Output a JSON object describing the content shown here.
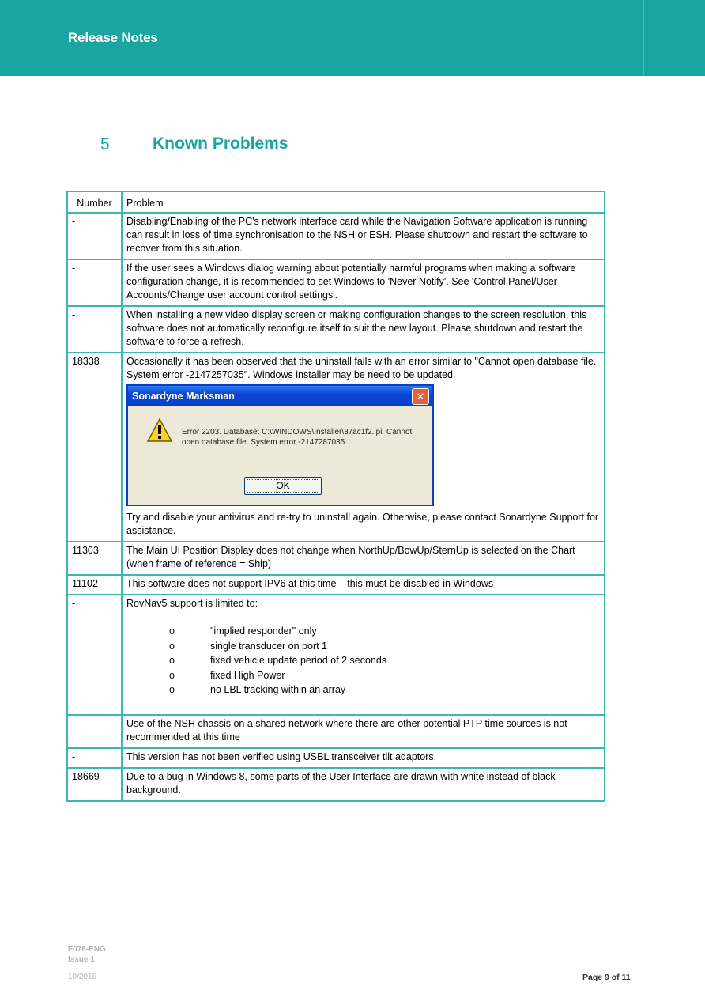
{
  "header": {
    "title": "Release Notes"
  },
  "section": {
    "number": "5",
    "title": "Known Problems"
  },
  "table": {
    "headers": {
      "number": "Number",
      "problem": "Problem"
    },
    "rows": [
      {
        "number": "-",
        "text": "Disabling/Enabling of the PC's network interface card while the Navigation Software application is running can result in loss of time synchronisation to the NSH or ESH. Please shutdown and restart the software to recover from this situation."
      },
      {
        "number": "-",
        "text": "If the user sees a Windows dialog warning about potentially harmful programs when making a software configuration change, it is recommended to set Windows to 'Never Notify'. See 'Control Panel/User Accounts/Change user account control settings'."
      },
      {
        "number": "-",
        "text": "When installing a new video display screen or making configuration changes to the screen resolution, this software does not automatically reconfigure itself to suit the new layout. Please shutdown and restart the software to force a refresh."
      },
      {
        "number": "18338",
        "text": "Occasionally it has been observed that the uninstall fails with an error similar to \"Cannot open database file. System error -2147257035\". Windows installer may be need to be updated.",
        "after": "Try and disable your antivirus and re-try to uninstall again. Otherwise, please contact Sonardyne Support for assistance."
      },
      {
        "number": "11303",
        "text": "The Main UI Position Display does not change when NorthUp/BowUp/SternUp is selected on the Chart (when frame of reference = Ship)"
      },
      {
        "number": "11102",
        "text": "This software does not support IPV6 at this time – this must be disabled in Windows"
      },
      {
        "number": "-",
        "text": "RovNav5 support is limited to:",
        "items": [
          "\"implied responder\" only",
          "single transducer on port 1",
          "fixed vehicle update period of 2 seconds",
          "fixed High Power",
          "no LBL tracking within an array"
        ]
      },
      {
        "number": "-",
        "text": "Use of the NSH chassis on a shared network where there are other potential PTP time sources is not recommended at this time"
      },
      {
        "number": "-",
        "text": "This version has not been verified using USBL transceiver tilt adaptors."
      },
      {
        "number": "18669",
        "text": "Due to a bug in Windows 8, some parts of the User Interface are drawn with white instead of black background."
      }
    ]
  },
  "dialog": {
    "title": "Sonardyne Marksman",
    "message": "Error 2203. Database: C:\\WINDOWS\\Installer\\37ac1f2.ipi. Cannot open database file. System error -2147287035.",
    "ok_label": "OK",
    "close_glyph": "✕"
  },
  "bullet_glyph": "o",
  "footer": {
    "code": "F076-ENG",
    "issue": "Issue 1",
    "date": "10/2016",
    "page": "Page 9 of 11"
  },
  "colors": {
    "brand": "#1aa5a1",
    "table_border": "#3cb7b3"
  }
}
